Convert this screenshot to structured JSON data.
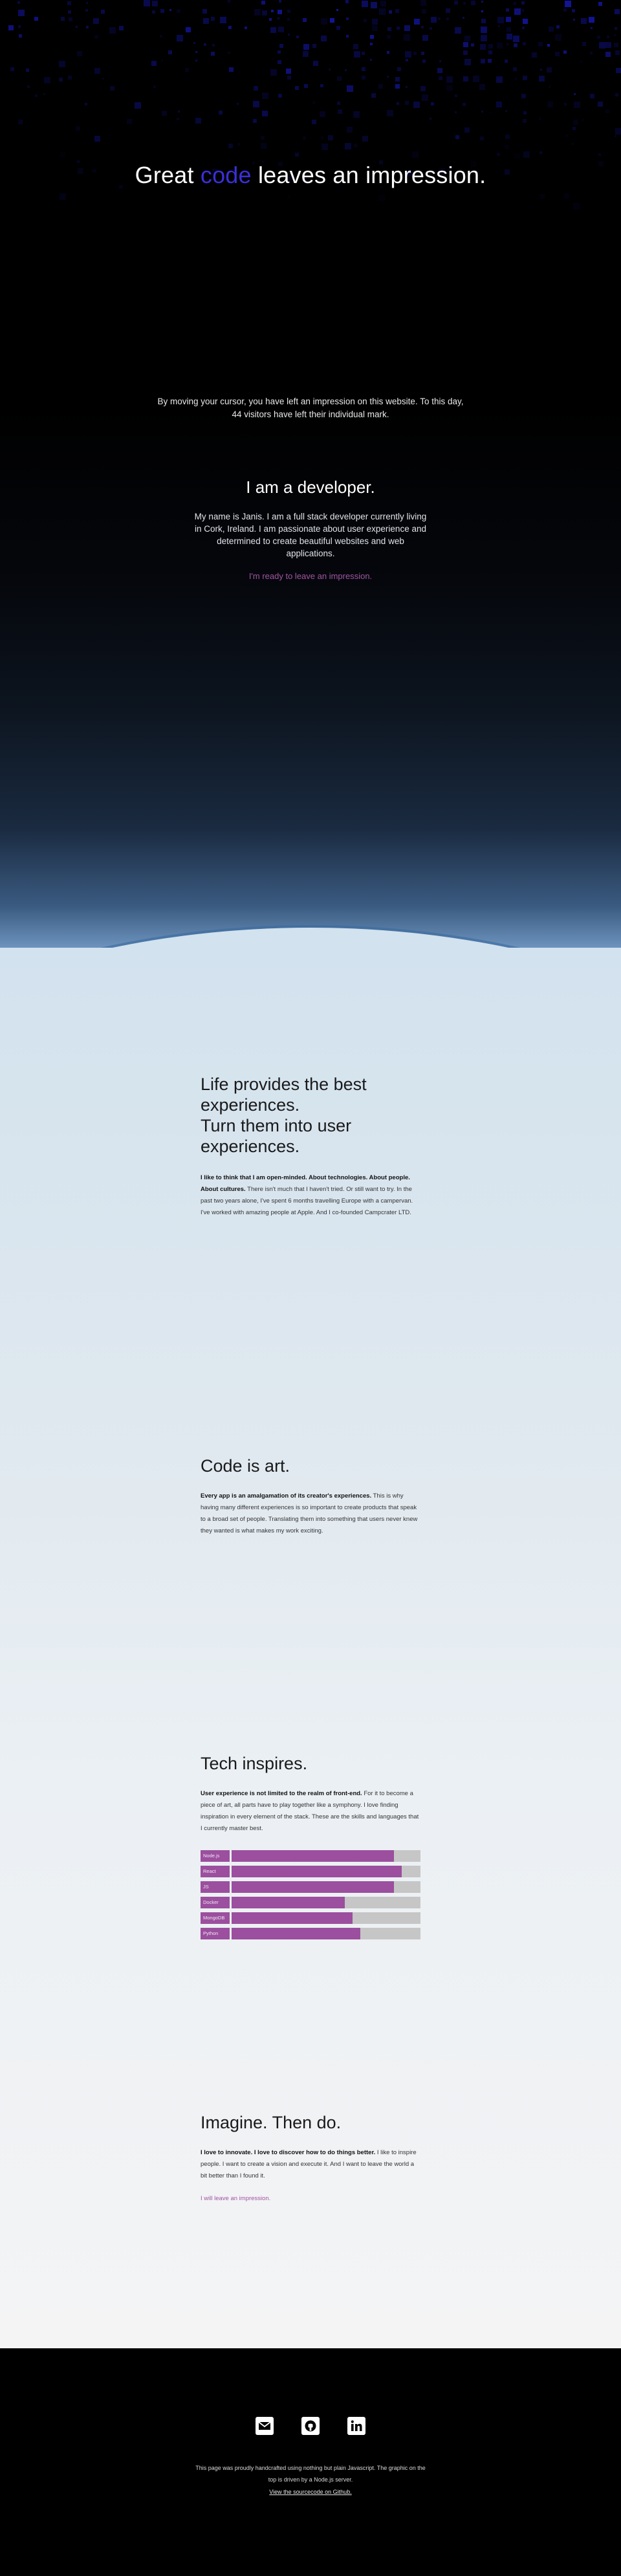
{
  "hero": {
    "title_before": "Great ",
    "title_accent": "code",
    "title_after": " leaves an impression.",
    "note": "By moving your cursor, you have left an impression on this website. To this day, 44 visitors have left their individual mark."
  },
  "developer": {
    "title": "I am a developer.",
    "text": "My name is Janis. I am a full stack developer currently living in Cork, Ireland. I am passionate about user experience and determined to create beautiful websites and web applications.",
    "link": "I'm ready to leave an impression."
  },
  "experiences": {
    "title_line1": "Life provides the best experiences.",
    "title_line2": "Turn them into user experiences.",
    "lead": "I like to think that I am open-minded. About technologies. About people. About cultures.",
    "body": " There isn't much that I haven't tried. Or still want to try. In the past two years alone, I've spent 6 months travelling Europe with a campervan. I've worked with amazing people at Apple. And I co-founded Campcrater LTD."
  },
  "art": {
    "title": "Code is art.",
    "lead": "Every app is an amalgamation of its creator's experiences.",
    "body": " This is why having many different experiences is so important to create products that speak to a broad set of people. Translating them into something that users never knew they wanted is what makes my work exciting."
  },
  "tech": {
    "title": "Tech inspires.",
    "lead": "User experience is not limited to the realm of front-end.",
    "body": " For it to become a piece of art, all parts have to play together like a symphony. I love finding inspiration in every element of the stack. These are the skills and languages that I currently master best.",
    "skills": [
      {
        "label": "Node.js",
        "level": 0.86
      },
      {
        "label": "React",
        "level": 0.9
      },
      {
        "label": "JS",
        "level": 0.86
      },
      {
        "label": "Docker",
        "level": 0.6
      },
      {
        "label": "MongoDB",
        "level": 0.64
      },
      {
        "label": "Python",
        "level": 0.68
      }
    ],
    "bar_color": "#9b4f9e",
    "track_color": "#c6c6c6"
  },
  "imagine": {
    "title": "Imagine. Then do.",
    "lead": "I love to innovate. I love to discover how to do things better.",
    "body": " I like to inspire people. I want to create a vision and execute it. And I want to leave the world a bit better than I found it.",
    "cta": "I will leave an impression."
  },
  "footer": {
    "icons": [
      "mail-icon",
      "github-icon",
      "linkedin-icon"
    ],
    "text": "This page was proudly handcrafted using nothing but plain Javascript. The graphic on the top is driven by a Node.js server.",
    "link": "View the sourcecode on Github."
  },
  "colors": {
    "accent_blue": "#3a2fd8",
    "accent_purple": "#a155a3",
    "dark_bg": "#000000"
  }
}
